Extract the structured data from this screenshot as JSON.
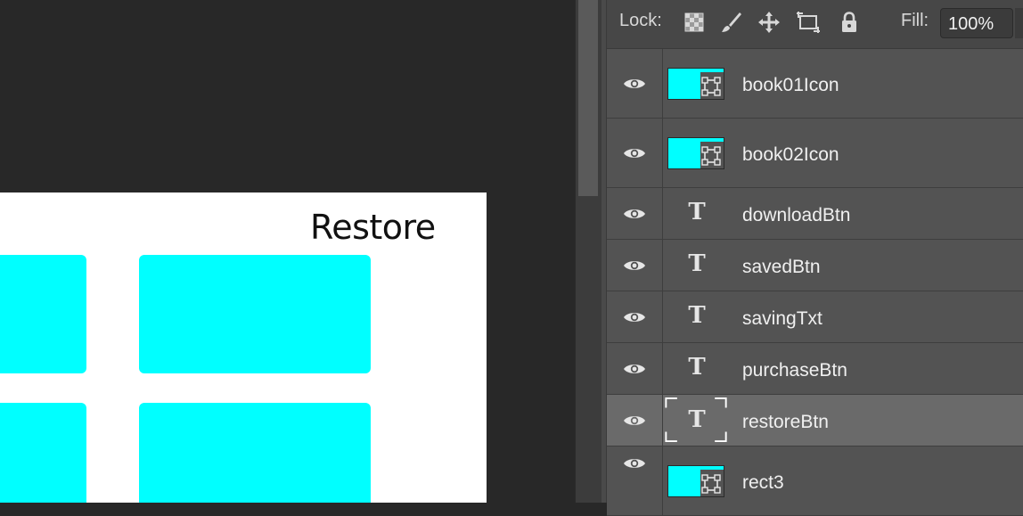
{
  "canvas": {
    "restore_text": "Restore",
    "colors": {
      "background": "#282828",
      "document": "#ffffff",
      "shape_fill": "#00ffff"
    }
  },
  "lock_bar": {
    "lock_label": "Lock:",
    "lock_icons": [
      "lock-transparent-pixels-icon",
      "lock-image-pixels-icon",
      "lock-position-icon",
      "lock-artboard-icon",
      "lock-all-icon"
    ],
    "fill_label": "Fill:",
    "fill_value": "100%"
  },
  "layers": [
    {
      "name": "book01Icon",
      "kind": "shape",
      "icon": "shape-thumbnail-icon",
      "selected": false
    },
    {
      "name": "book02Icon",
      "kind": "shape",
      "icon": "shape-thumbnail-icon",
      "selected": false
    },
    {
      "name": "downloadBtn",
      "kind": "text",
      "icon": "type-layer-icon",
      "selected": false
    },
    {
      "name": "savedBtn",
      "kind": "text",
      "icon": "type-layer-icon",
      "selected": false
    },
    {
      "name": "savingTxt",
      "kind": "text",
      "icon": "type-layer-icon",
      "selected": false
    },
    {
      "name": "purchaseBtn",
      "kind": "text",
      "icon": "type-layer-icon",
      "selected": false
    },
    {
      "name": "restoreBtn",
      "kind": "text",
      "icon": "type-layer-icon",
      "selected": true
    },
    {
      "name": "rect3",
      "kind": "shape",
      "icon": "shape-thumbnail-icon",
      "selected": false
    }
  ],
  "type_glyph": "T"
}
